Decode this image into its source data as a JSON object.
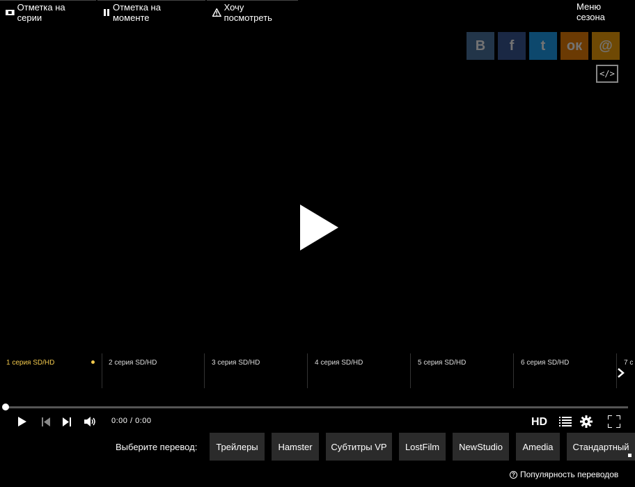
{
  "top_bar": {
    "mark_episode": "Отметка на серии",
    "mark_moment": "Отметка на моменте",
    "want_to_watch": "Хочу посмотреть",
    "season_menu": "Меню сезона"
  },
  "social": [
    {
      "name": "vk",
      "glyph": "В",
      "color": "#4c75a3"
    },
    {
      "name": "facebook",
      "glyph": "f",
      "color": "#3b5998"
    },
    {
      "name": "twitter",
      "glyph": "t",
      "color": "#1da1f2"
    },
    {
      "name": "odnoklassniki",
      "glyph": "ок",
      "color": "#ee8208"
    },
    {
      "name": "mail",
      "glyph": "@",
      "color": "#f5a30b"
    }
  ],
  "embed_glyph": "</>",
  "episodes": [
    {
      "label": "1 серия SD/HD",
      "active": true
    },
    {
      "label": "2 серия SD/HD",
      "active": false
    },
    {
      "label": "3 серия SD/HD",
      "active": false
    },
    {
      "label": "4 серия SD/HD",
      "active": false
    },
    {
      "label": "5 серия SD/HD",
      "active": false
    },
    {
      "label": "6 серия SD/HD",
      "active": false
    },
    {
      "label": "7 с",
      "active": false
    }
  ],
  "player": {
    "time": "0:00 / 0:00",
    "quality": "HD",
    "progress": 0
  },
  "translation": {
    "label": "Выберите перевод:",
    "options": [
      "Трейлеры",
      "Hamster",
      "Субтитры VP",
      "LostFilm",
      "NewStudio",
      "Amedia",
      "Стандартный"
    ],
    "popularity": "Популярность переводов"
  },
  "colors": {
    "accent": "#f2c94c",
    "button_bg": "#2b2b2b"
  }
}
